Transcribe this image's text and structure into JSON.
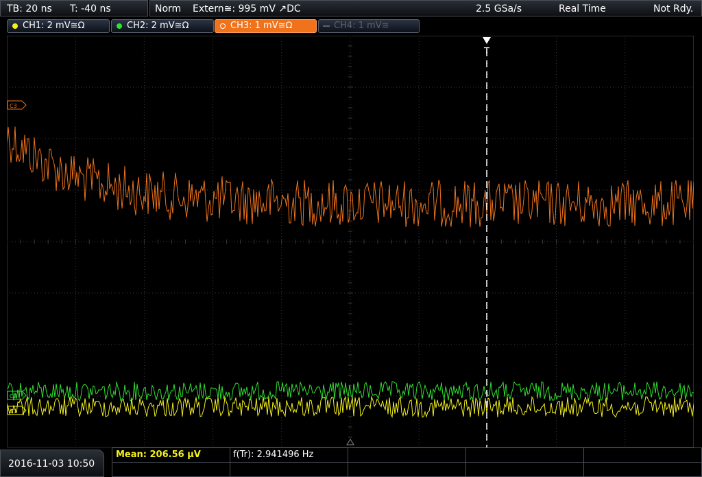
{
  "status_bar": {
    "timebase": "TB: 20 ns",
    "trigger_time": "T: -40 ns",
    "mode": "Norm",
    "trigger_source": "Extern≅: 995 mV ↗DC",
    "sample_rate": "2.5 GSa/s",
    "acquisition": "Real Time",
    "state": "Not Rdy."
  },
  "channels": [
    {
      "label": "CH1: 2 mV≅Ω",
      "color": "#f5f21c",
      "active": false,
      "enabled": true
    },
    {
      "label": "CH2: 2 mV≅Ω",
      "color": "#30e030",
      "active": false,
      "enabled": true
    },
    {
      "label": "CH3: 1 mV≅Ω",
      "color": "#f0731c",
      "active": true,
      "enabled": true
    },
    {
      "label": "CH4: 1 mV≅",
      "color": "#5e636b",
      "active": false,
      "enabled": false
    }
  ],
  "markers": {
    "ch3": "C3",
    "ch2": "C2",
    "ch1": "C1",
    "trigger": "T"
  },
  "footer": {
    "datetime": "2016-11-03 10:50",
    "measurement_1": "Mean: 206.56 µV",
    "measurement_2": "f(Tr): 2.941496 Hz"
  }
}
